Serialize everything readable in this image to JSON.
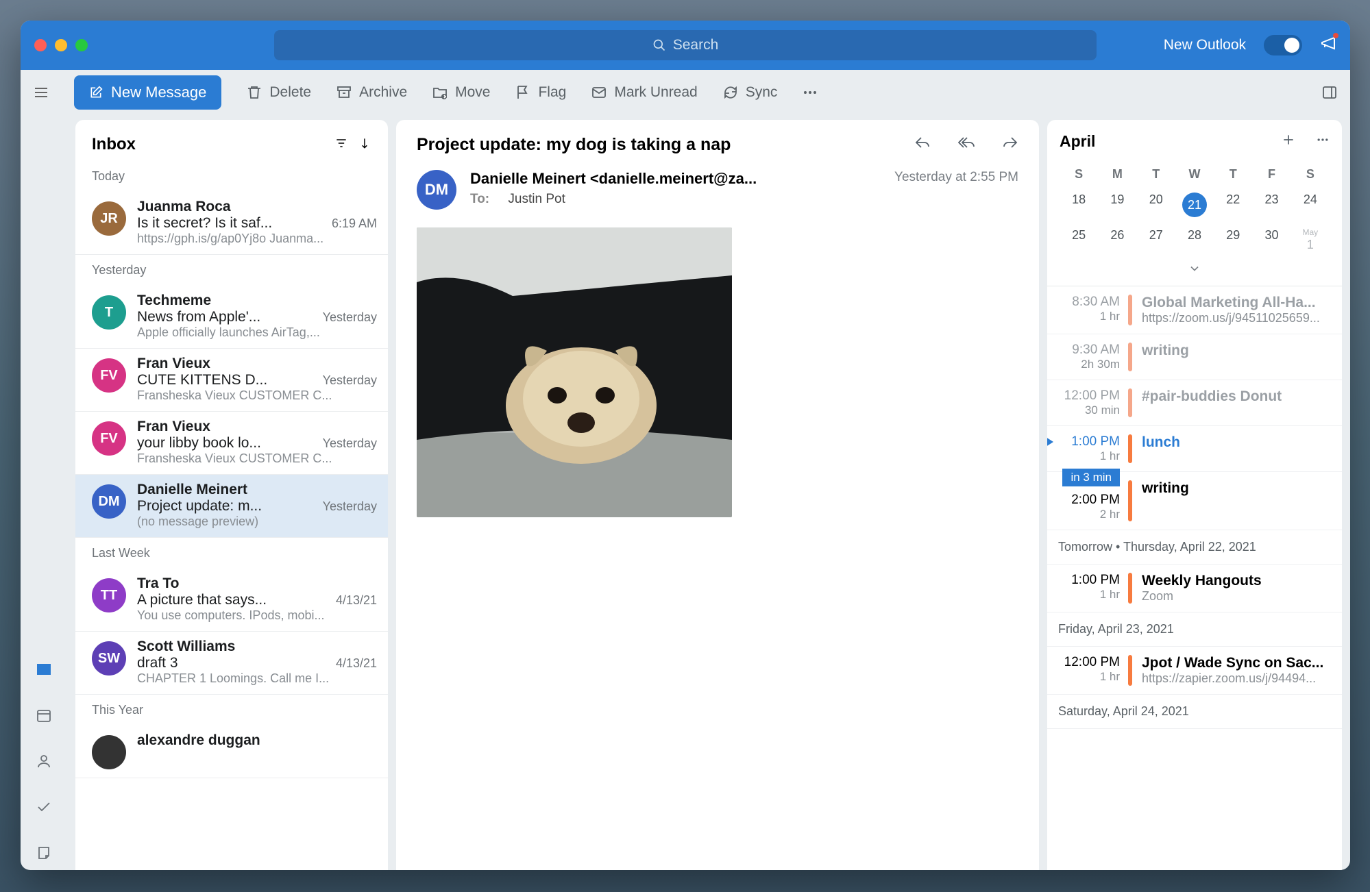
{
  "titlebar": {
    "search_placeholder": "Search",
    "new_outlook_label": "New Outlook"
  },
  "toolbar": {
    "new_message": "New Message",
    "delete": "Delete",
    "archive": "Archive",
    "move": "Move",
    "flag": "Flag",
    "mark_unread": "Mark Unread",
    "sync": "Sync"
  },
  "msglist": {
    "title": "Inbox",
    "sections": [
      {
        "label": "Today",
        "messages": [
          {
            "initials": "JR",
            "color": "#9a6a3c",
            "from": "Juanma Roca",
            "subject": "Is it secret? Is it saf...",
            "date": "6:19 AM",
            "preview": "https://gph.is/g/ap0Yj8o Juanma..."
          }
        ]
      },
      {
        "label": "Yesterday",
        "messages": [
          {
            "initials": "T",
            "color": "#1d9e8f",
            "from": "Techmeme",
            "subject": "News from Apple'...",
            "date": "Yesterday",
            "preview": "Apple officially launches AirTag,..."
          },
          {
            "initials": "FV",
            "color": "#d63384",
            "from": "Fran Vieux",
            "subject": "CUTE KITTENS D...",
            "date": "Yesterday",
            "preview": "Fransheska Vieux CUSTOMER C..."
          },
          {
            "initials": "FV",
            "color": "#d63384",
            "from": "Fran Vieux",
            "subject": "your libby book lo...",
            "date": "Yesterday",
            "preview": "Fransheska Vieux CUSTOMER C..."
          },
          {
            "initials": "DM",
            "color": "#3862c6",
            "from": "Danielle Meinert",
            "subject": "Project update: m...",
            "date": "Yesterday",
            "preview": "(no message preview)",
            "selected": true
          }
        ]
      },
      {
        "label": "Last Week",
        "messages": [
          {
            "initials": "TT",
            "color": "#8e3cc7",
            "from": "Tra To",
            "subject": "A picture that says...",
            "date": "4/13/21",
            "preview": "You use computers. IPods, mobi..."
          },
          {
            "initials": "SW",
            "color": "#5d3fb5",
            "from": "Scott Williams",
            "subject": "draft 3",
            "date": "4/13/21",
            "preview": "CHAPTER 1 Loomings. Call me I..."
          }
        ]
      },
      {
        "label": "This Year",
        "messages": [
          {
            "initials": "",
            "color": "#333",
            "from": "alexandre duggan",
            "subject": "",
            "date": "",
            "preview": ""
          }
        ]
      }
    ]
  },
  "reader": {
    "subject": "Project update: my dog is taking a nap",
    "avatar_initials": "DM",
    "from": "Danielle Meinert <danielle.meinert@za...",
    "to_label": "To:",
    "to": "Justin Pot",
    "date": "Yesterday at 2:55 PM"
  },
  "calendar": {
    "month": "April",
    "dow": [
      "S",
      "M",
      "T",
      "W",
      "T",
      "F",
      "S"
    ],
    "weeks": [
      [
        "18",
        "19",
        "20",
        "21",
        "22",
        "23",
        "24"
      ],
      [
        "25",
        "26",
        "27",
        "28",
        "29",
        "30",
        "May 1"
      ]
    ],
    "today": "21",
    "events_today": [
      {
        "time": "8:30 AM",
        "dur": "1 hr",
        "title": "Global Marketing All-Ha...",
        "sub": "https://zoom.us/j/94511025659...",
        "color": "#f5a78a",
        "dim": true
      },
      {
        "time": "9:30 AM",
        "dur": "2h 30m",
        "title": "writing",
        "sub": "",
        "color": "#f5a78a",
        "dim": true
      },
      {
        "time": "12:00 PM",
        "dur": "30 min",
        "title": "#pair-buddies Donut",
        "sub": "",
        "color": "#f5a78a",
        "dim": true
      },
      {
        "time": "1:00 PM",
        "dur": "1 hr",
        "title": "lunch",
        "sub": "",
        "color": "#f77b3f",
        "current": true
      },
      {
        "time": "2:00 PM",
        "dur": "2 hr",
        "title": "writing",
        "sub": "",
        "color": "#f77b3f",
        "soon": "in 3 min"
      }
    ],
    "future_days": [
      {
        "header": "Tomorrow  •  Thursday, April 22, 2021",
        "events": [
          {
            "time": "1:00 PM",
            "dur": "1 hr",
            "title": "Weekly Hangouts",
            "sub": "Zoom",
            "color": "#f77b3f"
          }
        ]
      },
      {
        "header": "Friday, April 23, 2021",
        "events": [
          {
            "time": "12:00 PM",
            "dur": "1 hr",
            "title": "Jpot / Wade Sync on Sac...",
            "sub": "https://zapier.zoom.us/j/94494...",
            "color": "#f77b3f"
          }
        ]
      },
      {
        "header": "Saturday, April 24, 2021",
        "events": []
      }
    ]
  }
}
